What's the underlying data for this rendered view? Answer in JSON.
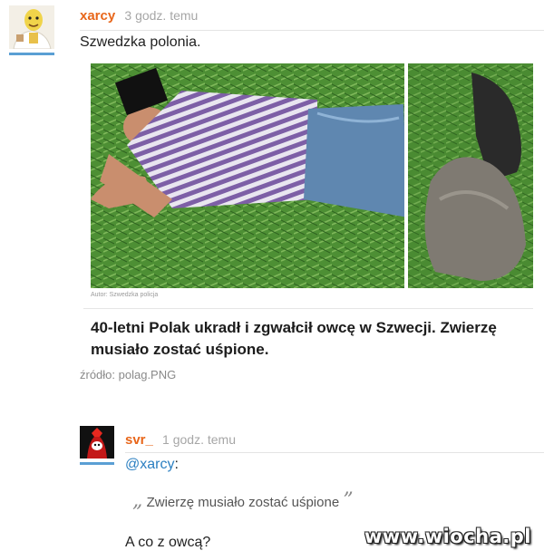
{
  "comments": [
    {
      "author": "xarcy",
      "time": "3 godz. temu",
      "text": "Szwedzka polonia.",
      "embed": {
        "credit": "Autor: Szwedzka policja",
        "headline": "40-letni Polak ukradł i zgwałcił owcę w Szwecji. Zwierzę musiało zostać uśpione."
      },
      "source": "źródło: polag.PNG"
    },
    {
      "author": "svr_",
      "time": "1 godz. temu",
      "mention": "@xarcy",
      "mention_suffix": ":",
      "quote": "Zwierzę musiało zostać uśpione",
      "quote_open": "„",
      "quote_close": "”",
      "text": "A co z owcą?"
    }
  ],
  "watermark": "www.wiocha.pl",
  "colors": {
    "author": "#e8661a",
    "mention": "#2b7fc1",
    "avatar_underline": "#5a9fd4"
  }
}
